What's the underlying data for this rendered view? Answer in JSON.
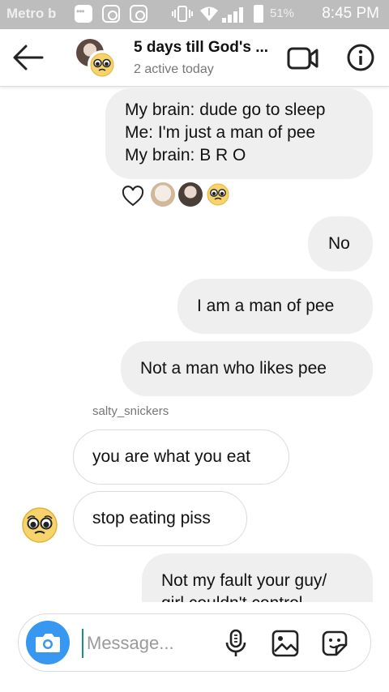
{
  "status_bar": {
    "carrier": "Metro b",
    "battery": "51%",
    "time": "8:45 PM"
  },
  "header": {
    "title": "5 days till God's ...",
    "subtitle": "2 active today"
  },
  "messages": [
    {
      "side": "mine",
      "lines": [
        "My brain: dude go to sleep",
        "Me: I'm just a man of pee",
        "My brain: B R O"
      ]
    },
    {
      "side": "mine",
      "lines": [
        "No"
      ]
    },
    {
      "side": "mine",
      "lines": [
        "I am a man of pee"
      ]
    },
    {
      "side": "mine",
      "lines": [
        "Not a man who likes pee"
      ]
    },
    {
      "side": "theirs",
      "lines": [
        "you are what you eat"
      ]
    },
    {
      "side": "theirs",
      "lines": [
        "stop eating piss"
      ]
    },
    {
      "side": "mine",
      "lines": [
        "Not my fault your guy/",
        "girl couldn't control"
      ]
    }
  ],
  "sender_name": "salty_snickers",
  "composer": {
    "placeholder": "Message..."
  },
  "colors": {
    "accent": "#3897f0",
    "my_bubble": "#efefef",
    "status_bar": "#bdbdbd"
  }
}
